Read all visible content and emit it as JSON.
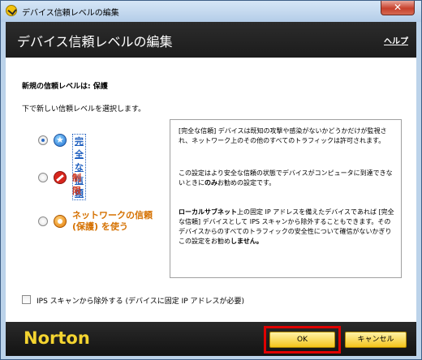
{
  "window": {
    "title": "デバイス信頼レベルの編集",
    "close_glyph": "✕"
  },
  "header": {
    "title": "デバイス信頼レベルの編集",
    "help_label": "ヘルプ"
  },
  "content": {
    "new_level": "新規の信頼レベルは: 保護",
    "instruction": "下で新しい信頼レベルを選択します。",
    "options": [
      {
        "label": "完全な信頼",
        "icon": "star-shield-icon",
        "selected": true
      },
      {
        "label": "制限",
        "icon": "restrict-icon",
        "selected": false
      },
      {
        "label_line1": "ネットワークの信頼",
        "label_line2": "(保護) を使う",
        "icon": "network-protect-icon",
        "selected": false
      }
    ],
    "descriptions": {
      "full": "[完全な信頼] デバイスは既知の攻撃や感染がないかどうかだけが監視され、ネットワーク上のその他のすべてのトラフィックは許可されます。",
      "restrict_part1": "この設定はより安全な信頼の状態でデバイスがコンピュータに到達できないときに",
      "restrict_bold": "のみ",
      "restrict_part2": "お勧めの設定です。",
      "public_bold1": "ローカルサブネット",
      "public_part1": "上の固定 IP アドレスを備えたデバイスであれば [完全な信頼] デバイスとして IPS スキャンから除外することもできます。そのデバイスからのすべてのトラフィックの安全性について確信がないかぎりこの設定をお勧め",
      "public_bold2": "しません。"
    },
    "ips_checkbox_label": "IPS スキャンから除外する (デバイスに固定 IP アドレスが必要)"
  },
  "footer": {
    "brand": "Norton",
    "ok_label": "OK",
    "cancel_label": "キャンセル"
  },
  "colors": {
    "header_bg": "#1c1c1c",
    "selected_label": "#1f5fbf",
    "option_label": "#d0351b",
    "button_bg": "#f4c41a",
    "highlight": "#e00000"
  }
}
